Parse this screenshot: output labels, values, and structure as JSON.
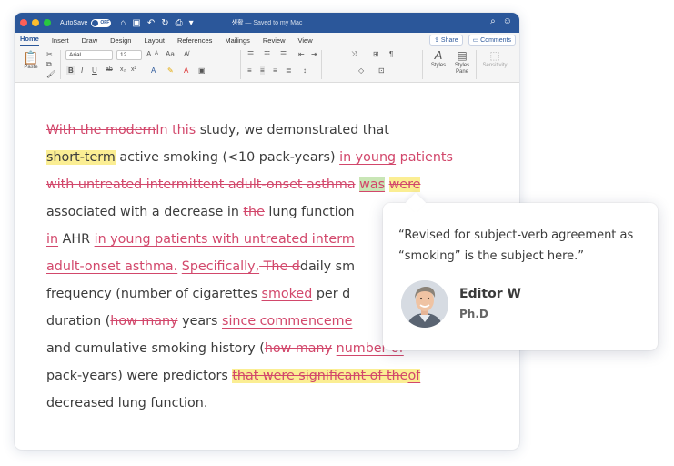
{
  "colors": {
    "titlebar": "#2b579a",
    "tracked_change": "#d2476b",
    "highlight_yellow": "#fbee93",
    "highlight_green": "#c9e6b6",
    "close": "#fe5f57",
    "minimize": "#febc2e",
    "zoom": "#28c840"
  },
  "titlebar": {
    "autosave_label": "AutoSave",
    "autosave_state": "OFF",
    "doc_name": "생활",
    "doc_status": "— Saved to my Mac",
    "icons": [
      "home-icon",
      "save-icon",
      "undo-icon",
      "redo-icon",
      "print-icon",
      "more-icon",
      "search-icon",
      "smiley-icon"
    ]
  },
  "tabs": [
    "Home",
    "Insert",
    "Draw",
    "Design",
    "Layout",
    "References",
    "Mailings",
    "Review",
    "View"
  ],
  "active_tab": "Home",
  "share_label": "Share",
  "comments_label": "Comments",
  "ribbon": {
    "paste_label": "Paste",
    "font_name": "Arial",
    "font_size": "12",
    "styles_label": "Styles",
    "styles_pane_label1": "Styles",
    "styles_pane_label2": "Pane",
    "sensitivity_label": "Sensitivity",
    "format_buttons": [
      "B",
      "I",
      "U",
      "ab",
      "x₂",
      "x²"
    ],
    "case_button": "Aa"
  },
  "document": {
    "lines": [
      [
        {
          "t": "With the modern",
          "s": "del"
        },
        {
          "t": "In this",
          "s": "ins"
        },
        {
          "t": " study, we demonstrated that",
          "s": ""
        }
      ],
      [
        {
          "t": "short-term",
          "s": "hl"
        },
        {
          "t": " active smoking (<10 pack-years) ",
          "s": ""
        },
        {
          "t": "in young",
          "s": "ins"
        },
        {
          "t": " ",
          "s": ""
        },
        {
          "t": "patients",
          "s": "del"
        }
      ],
      [
        {
          "t": "with untreated intermittent adult-onset asthma",
          "s": "del"
        },
        {
          "t": " ",
          "s": ""
        },
        {
          "t": "was",
          "s": "ins-green"
        },
        {
          "t": " ",
          "s": ""
        },
        {
          "t": "were",
          "s": "del-hl"
        },
        {
          "t": " ",
          "s": "hl"
        }
      ],
      [
        {
          "t": "associated with a decrease in ",
          "s": ""
        },
        {
          "t": "the",
          "s": "del"
        },
        {
          "t": " lung function",
          "s": ""
        }
      ],
      [
        {
          "t": "in",
          "s": "ins"
        },
        {
          "t": " AHR ",
          "s": ""
        },
        {
          "t": "in young patients with untreated interm",
          "s": "ins"
        }
      ],
      [
        {
          "t": "adult-onset asthma.",
          "s": "ins"
        },
        {
          "t": " ",
          "s": ""
        },
        {
          "t": "Specifically,",
          "s": "ins"
        },
        {
          "t": " The d",
          "s": "del"
        },
        {
          "t": "daily sm",
          "s": ""
        }
      ],
      [
        {
          "t": "frequency (number of cigarettes ",
          "s": ""
        },
        {
          "t": "smoked",
          "s": "ins"
        },
        {
          "t": " per d",
          "s": ""
        }
      ],
      [
        {
          "t": "duration (",
          "s": ""
        },
        {
          "t": "how many",
          "s": "del"
        },
        {
          "t": " years ",
          "s": ""
        },
        {
          "t": "since commenceme",
          "s": "ins"
        }
      ],
      [
        {
          "t": "and cumulative smoking history (",
          "s": ""
        },
        {
          "t": "how many",
          "s": "del"
        },
        {
          "t": " ",
          "s": ""
        },
        {
          "t": "number of",
          "s": "ins"
        }
      ],
      [
        {
          "t": "pack-years) were predictors ",
          "s": ""
        },
        {
          "t": "that were significant of the",
          "s": "del-hl"
        },
        {
          "t": "of",
          "s": "ins-hl"
        },
        {
          "t": " ",
          "s": "hl"
        }
      ],
      [
        {
          "t": "decreased lung function.",
          "s": ""
        }
      ]
    ]
  },
  "comment": {
    "text": "“Revised for subject-verb agreement as “smoking” is the subject here.”",
    "author": "Editor W",
    "role": "Ph.D"
  }
}
